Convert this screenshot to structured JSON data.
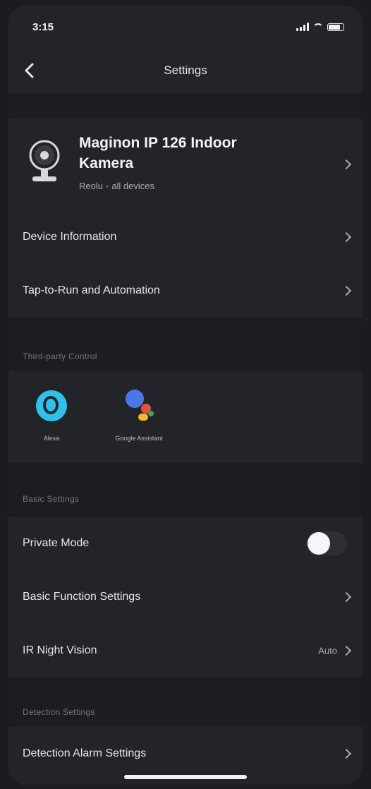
{
  "status_bar": {
    "time": "3:15"
  },
  "nav": {
    "title": "Settings"
  },
  "device": {
    "name": "Maginon IP 126 Indoor Kamera",
    "subtitle_left": "Reolu",
    "subtitle_right": "all devices",
    "icon": "camera-icon"
  },
  "rows_top": [
    {
      "label": "Device Information"
    },
    {
      "label": "Tap-to-Run and Automation"
    }
  ],
  "third_party": {
    "section_title": "Third-party Control",
    "assistants": [
      {
        "label": "Alexa",
        "icon": "alexa-icon"
      },
      {
        "label": "Google Assistant",
        "icon": "google-assistant-icon"
      }
    ]
  },
  "basic": {
    "section_title": "Basic Settings",
    "private_mode": {
      "label": "Private Mode",
      "enabled": false
    },
    "basic_function": {
      "label": "Basic Function Settings"
    },
    "ir_night": {
      "label": "IR Night Vision",
      "value": "Auto"
    }
  },
  "detection": {
    "section_title": "Detection Settings",
    "alarm": {
      "label": "Detection Alarm Settings"
    }
  }
}
